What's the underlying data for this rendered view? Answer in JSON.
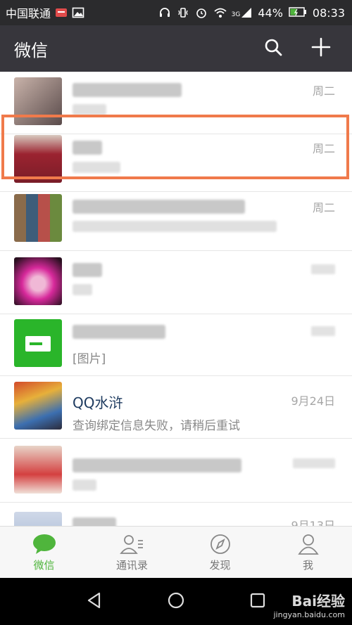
{
  "status_bar": {
    "carrier": "中国联通",
    "network_label": "3G",
    "battery": "44%",
    "time": "08:33"
  },
  "title_bar": {
    "title": "微信",
    "search_icon": "search-icon",
    "add_icon": "plus-icon"
  },
  "chats": [
    {
      "time": "周二"
    },
    {
      "time": "周二"
    },
    {
      "time": "周二"
    },
    {
      "time": ""
    },
    {
      "time": "",
      "preview": "[图片]"
    },
    {
      "name": "QQ水浒",
      "preview": "查询绑定信息失败，请稍后重试",
      "time": "9月24日"
    },
    {
      "time": ""
    },
    {
      "time": "9月13日"
    }
  ],
  "tabs": [
    {
      "label": "微信",
      "icon": "chat-bubble-icon",
      "active": true
    },
    {
      "label": "通讯录",
      "icon": "contacts-icon",
      "active": false
    },
    {
      "label": "发现",
      "icon": "compass-icon",
      "active": false
    },
    {
      "label": "我",
      "icon": "person-icon",
      "active": false
    }
  ],
  "watermark": {
    "brand": "Bai经验",
    "url": "jingyan.baidu.com"
  },
  "colors": {
    "accent_green": "#4fb53c",
    "highlight_orange": "#f07a4b",
    "header_bg": "#37363c"
  }
}
